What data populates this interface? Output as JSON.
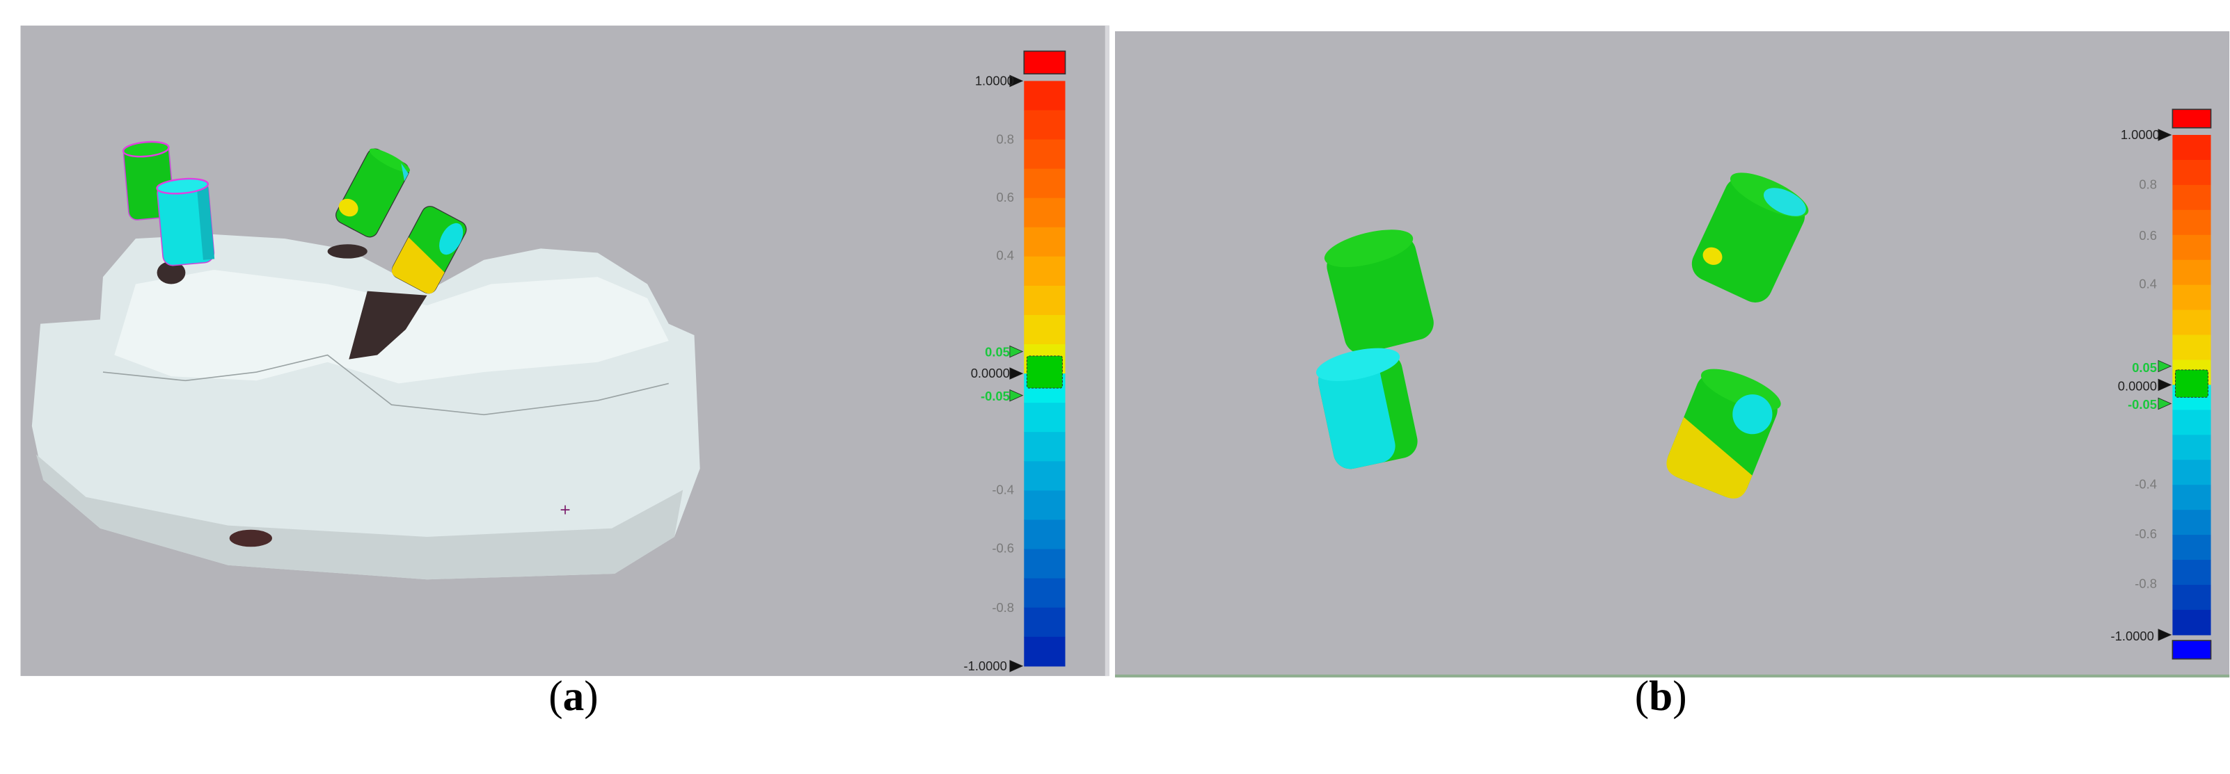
{
  "panels": [
    {
      "caption_open": "(",
      "caption_letter": "a",
      "caption_close": ")",
      "background": "#b4b4b9",
      "colorbar": {
        "ticks": [
          "1.0000",
          "0.8",
          "0.6",
          "0.4",
          "0.05",
          "0.0000",
          "-0.05",
          "-0.4",
          "-0.6",
          "-0.8",
          "-1.0000"
        ],
        "over_color": "#ff0000",
        "under_color": null
      }
    },
    {
      "caption_open": "(",
      "caption_letter": "b",
      "caption_close": ")",
      "background": "#b4b4b9",
      "colorbar": {
        "ticks": [
          "1.0000",
          "0.8",
          "0.6",
          "0.4",
          "0.05",
          "0.0000",
          "-0.05",
          "-0.4",
          "-0.6",
          "-0.8",
          "-1.0000"
        ],
        "over_color": "#ff0000",
        "under_color": "#0000ff"
      }
    }
  ],
  "colorbar_scale": {
    "range": [
      -1.0,
      1.0
    ],
    "tolerance": [
      -0.05,
      0.05
    ],
    "nominal_color": "#00cc00",
    "positive_bands": [
      "#ff2a00",
      "#ff4000",
      "#ff5500",
      "#ff6a00",
      "#ff7f00",
      "#ff9500",
      "#ffaa00",
      "#fbbf00",
      "#f5d500",
      "#eaea00"
    ],
    "negative_bands": [
      "#00ecec",
      "#00d5e5",
      "#00bfdf",
      "#00aadb",
      "#0095d5",
      "#0080cf",
      "#006ac8",
      "#0055c2",
      "#0040bb",
      "#002ab5"
    ]
  }
}
